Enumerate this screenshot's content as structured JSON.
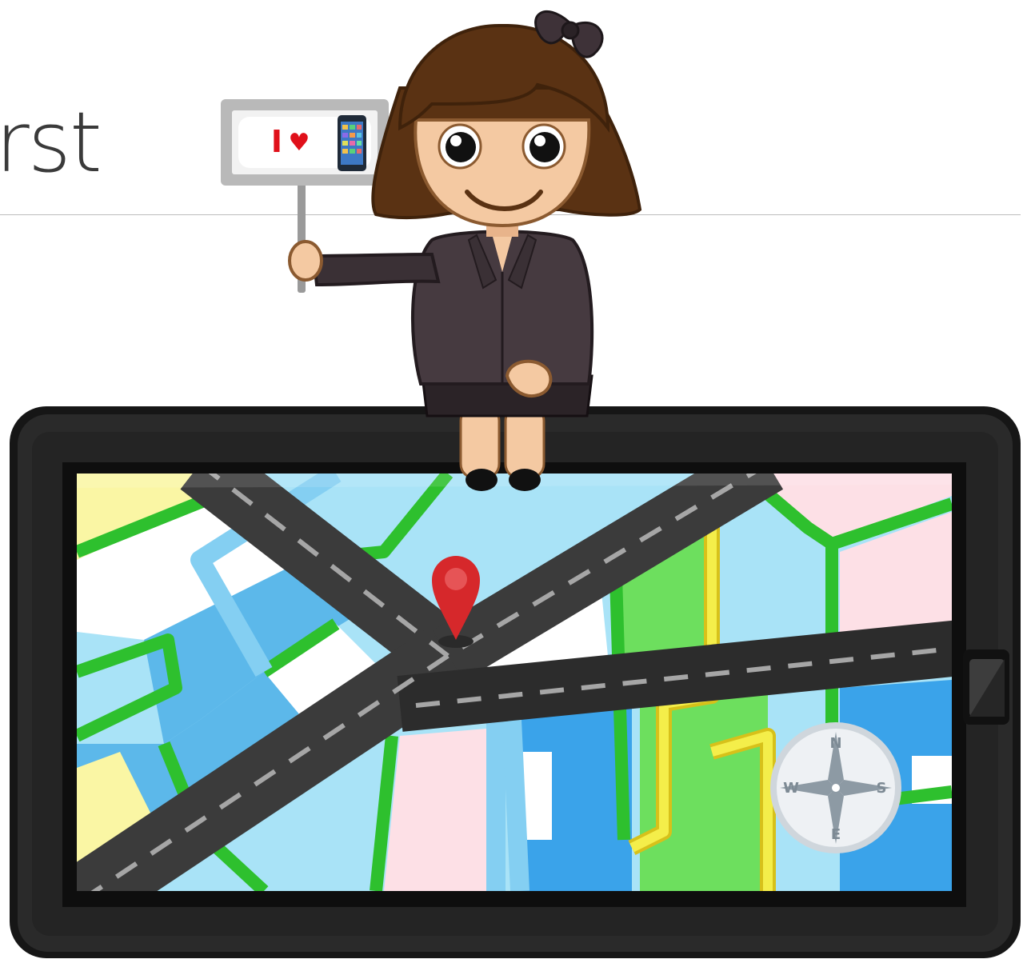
{
  "page": {
    "heading_fragment": "rst"
  },
  "illustration": {
    "sign_text_i": "I",
    "sign_text_heart": "♥",
    "compass": {
      "north": "N",
      "south": "S",
      "east": "E",
      "west": "W"
    },
    "colors": {
      "device_frame": "#1c1c1c",
      "road": "#3b3b3b",
      "road_dash": "#9a9a9a",
      "water": "#a9e3f7",
      "park_green": "#2ec02e",
      "pin_red": "#d6282b",
      "sign_heart": "#e0101a"
    }
  }
}
